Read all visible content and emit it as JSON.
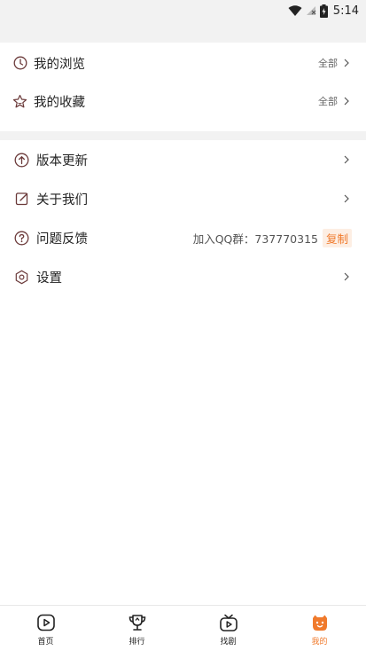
{
  "status_bar": {
    "time": "5:14"
  },
  "history_group": {
    "browse": {
      "label": "我的浏览",
      "action": "全部"
    },
    "favorites": {
      "label": "我的收藏",
      "action": "全部"
    }
  },
  "settings_group": {
    "update": {
      "label": "版本更新"
    },
    "about": {
      "label": "关于我们"
    },
    "feedback": {
      "label": "问题反馈",
      "qq_text": "加入QQ群：737770315",
      "copy_label": "复制"
    },
    "settings": {
      "label": "设置"
    }
  },
  "bottom_nav": {
    "items": [
      {
        "label": "首页",
        "icon": "play-icon"
      },
      {
        "label": "排行",
        "icon": "trophy-icon"
      },
      {
        "label": "找剧",
        "icon": "tv-icon"
      },
      {
        "label": "我的",
        "icon": "profile-icon"
      }
    ],
    "active_index": 3
  },
  "colors": {
    "accent": "#f07a2c",
    "icon_dark": "#6b3a3a",
    "background": "#f2f2f2"
  }
}
